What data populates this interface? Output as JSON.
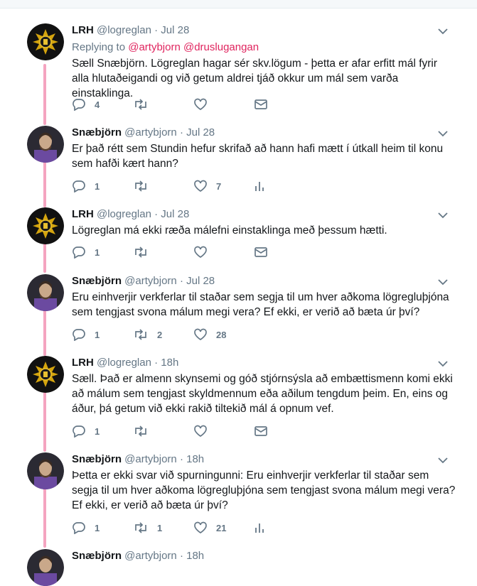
{
  "tweets": [
    {
      "name": "LRH",
      "handle": "@logreglan",
      "dot": "·",
      "time": "Jul 28",
      "reply_prefix": "Replying to",
      "mentions": [
        "@artybjorn",
        "@druslugangan"
      ],
      "text": "Sæll Snæbjörn. Lögreglan hagar sér skv.lögum - þetta er afar erfitt mál fyrir alla hlutaðeigandi og við getum aldrei tjáð okkur um mál sem varða einstaklinga.",
      "replies": "4",
      "retweets": "",
      "likes": "",
      "last_icon": "mail-icon"
    },
    {
      "name": "Snæbjörn",
      "handle": "@artybjorn",
      "dot": "·",
      "time": "Jul 28",
      "text": "Er það rétt sem Stundin hefur skrifað að hann hafi mætt í útkall heim til konu sem hafði kært hann?",
      "replies": "1",
      "retweets": "",
      "likes": "7",
      "last_icon": "analytics-icon"
    },
    {
      "name": "LRH",
      "handle": "@logreglan",
      "dot": "·",
      "time": "Jul 28",
      "text": "Lögreglan má ekki ræða málefni einstaklinga með þessum hætti.",
      "replies": "1",
      "retweets": "",
      "likes": "",
      "last_icon": "mail-icon"
    },
    {
      "name": "Snæbjörn",
      "handle": "@artybjorn",
      "dot": "·",
      "time": "Jul 28",
      "text": "Eru einhverjir verkferlar til staðar sem segja til um hver aðkoma lögregluþjóna sem tengjast svona málum megi vera? Ef ekki, er verið að bæta úr því?",
      "replies": "1",
      "retweets": "2",
      "likes": "28",
      "last_icon": "none"
    },
    {
      "name": "LRH",
      "handle": "@logreglan",
      "dot": "·",
      "time": "18h",
      "text": "Sæll. Það er almenn skynsemi og góð stjórnsýsla að embættismenn komi ekki að málum sem tengjast skyldmennum eða aðilum tengdum þeim. En, eins og áður, þá getum við ekki rakið tiltekið mál á opnum vef.",
      "replies": "1",
      "retweets": "",
      "likes": "",
      "last_icon": "mail-icon"
    },
    {
      "name": "Snæbjörn",
      "handle": "@artybjorn",
      "dot": "·",
      "time": "18h",
      "text": "Þetta er ekki svar við spurningunni: Eru einhverjir verkferlar til staðar sem segja til um hver aðkoma lögregluþjóna sem tengjast svona málum megi vera? Ef ekki, er verið að bæta úr því?",
      "replies": "1",
      "retweets": "1",
      "likes": "21",
      "last_icon": "analytics-icon"
    },
    {
      "name": "Snæbjörn",
      "handle": "@artybjorn",
      "dot": "·",
      "time": "18h",
      "text": "",
      "replies": "",
      "retweets": "",
      "likes": "",
      "last_icon": "none"
    }
  ],
  "colors": {
    "mention": "#e0245e",
    "muted": "#657786",
    "thread": "#f4a4c0"
  }
}
